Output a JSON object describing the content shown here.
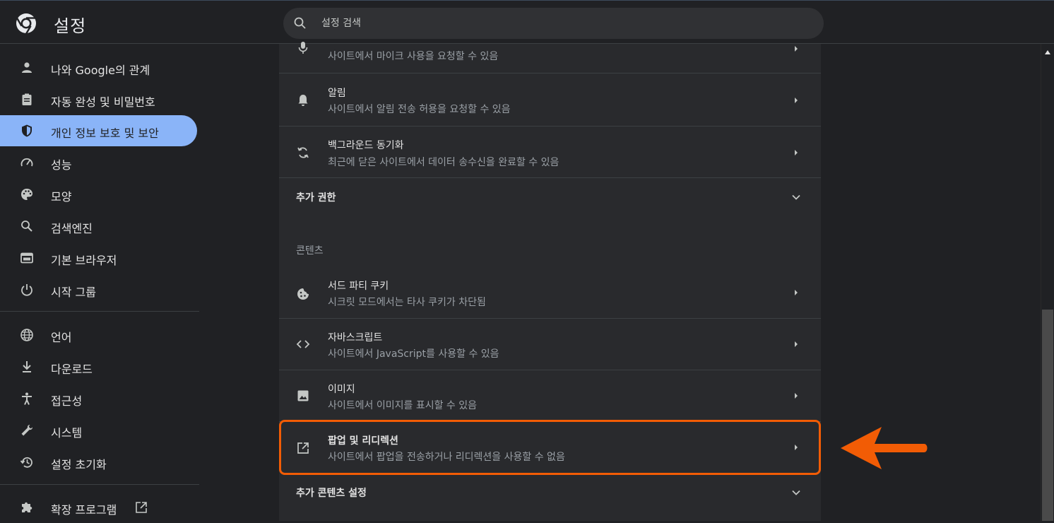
{
  "app": {
    "title": "설정"
  },
  "search": {
    "placeholder": "설정 검색"
  },
  "sidebar": {
    "items": [
      {
        "label": "나와 Google의 관계",
        "icon": "person-icon"
      },
      {
        "label": "자동 완성 및 비밀번호",
        "icon": "clipboard-icon"
      },
      {
        "label": "개인 정보 보호 및 보안",
        "icon": "shield-icon",
        "active": true
      },
      {
        "label": "성능",
        "icon": "speedometer-icon"
      },
      {
        "label": "모양",
        "icon": "palette-icon"
      },
      {
        "label": "검색엔진",
        "icon": "search-icon"
      },
      {
        "label": "기본 브라우저",
        "icon": "browser-window-icon"
      },
      {
        "label": "시작 그룹",
        "icon": "power-icon"
      },
      {
        "label": "언어",
        "icon": "globe-icon"
      },
      {
        "label": "다운로드",
        "icon": "download-icon"
      },
      {
        "label": "접근성",
        "icon": "accessibility-icon"
      },
      {
        "label": "시스템",
        "icon": "wrench-icon"
      },
      {
        "label": "설정 초기화",
        "icon": "history-icon"
      },
      {
        "label": "확장 프로그램",
        "icon": "puzzle-icon",
        "external": true
      }
    ]
  },
  "main": {
    "permissions": [
      {
        "title": "",
        "subtitle": "사이트에서 마이크 사용을 요청할 수 있음",
        "icon": "microphone-icon"
      },
      {
        "title": "알림",
        "subtitle": "사이트에서 알림 전송 허용을 요청할 수 있음",
        "icon": "bell-icon"
      },
      {
        "title": "백그라운드 동기화",
        "subtitle": "최근에 닫은 사이트에서 데이터 송수신을 완료할 수 있음",
        "icon": "sync-icon"
      }
    ],
    "more_permissions_label": "추가 권한",
    "content_section_label": "콘텐츠",
    "content": [
      {
        "title": "서드 파티 쿠키",
        "subtitle": "시크릿 모드에서는 타사 쿠키가 차단됨",
        "icon": "cookie-icon"
      },
      {
        "title": "자바스크립트",
        "subtitle": "사이트에서 JavaScript를 사용할 수 있음",
        "icon": "code-icon"
      },
      {
        "title": "이미지",
        "subtitle": "사이트에서 이미지를 표시할 수 있음",
        "icon": "image-icon"
      },
      {
        "title": "팝업 및 리디렉션",
        "subtitle": "사이트에서 팝업을 전송하거나 리디렉션을 사용할 수 없음",
        "icon": "open-in-new-icon",
        "highlighted": true
      }
    ],
    "more_content_label": "추가 콘텐츠 설정"
  },
  "colors": {
    "background": "#202124",
    "panel": "#292a2d",
    "active_nav": "#8ab4f8",
    "highlight": "#f25c05"
  }
}
